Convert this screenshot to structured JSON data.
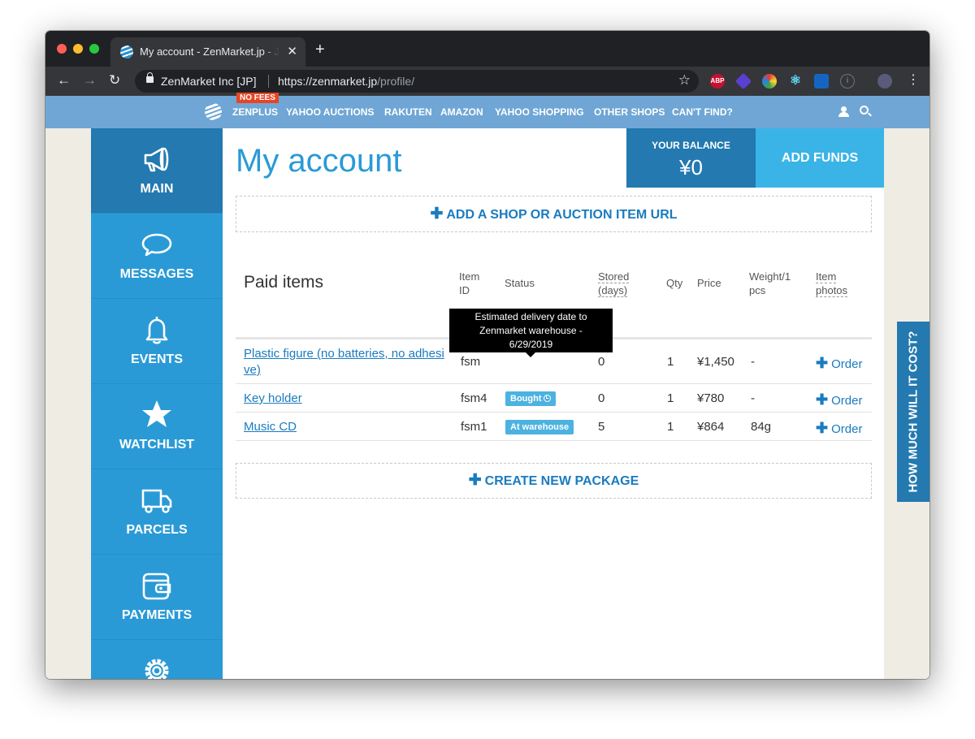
{
  "browser": {
    "tab_title": "My account - ZenMarket.jp - Japan",
    "site_name": "ZenMarket Inc [JP]",
    "url_host": "https://zenmarket.jp",
    "url_path": "/profile/",
    "ext_abp": "ABP"
  },
  "sitenav": {
    "badge": "NO FEES",
    "items": [
      "ZENPLUS",
      "YAHOO AUCTIONS",
      "RAKUTEN",
      "AMAZON",
      "YAHOO SHOPPING",
      "OTHER SHOPS",
      "CAN'T FIND?"
    ]
  },
  "sidebar": {
    "items": [
      {
        "label": "MAIN",
        "icon": "megaphone-icon"
      },
      {
        "label": "MESSAGES",
        "icon": "speech-bubble-icon"
      },
      {
        "label": "EVENTS",
        "icon": "bell-icon"
      },
      {
        "label": "WATCHLIST",
        "icon": "star-icon"
      },
      {
        "label": "PARCELS",
        "icon": "truck-icon"
      },
      {
        "label": "PAYMENTS",
        "icon": "wallet-icon"
      },
      {
        "label": "",
        "icon": "gear-icon"
      }
    ]
  },
  "main": {
    "title": "My account",
    "balance_label": "YOUR BALANCE",
    "balance_value": "¥0",
    "add_funds": "ADD FUNDS",
    "add_url": "ADD A SHOP OR AUCTION ITEM URL",
    "section_title": "Paid items",
    "columns": {
      "item_id_1": "Item",
      "item_id_2": "ID",
      "status": "Status",
      "stored_1": "Stored",
      "stored_2": "(days)",
      "qty": "Qty",
      "price": "Price",
      "weight_1": "Weight/1",
      "weight_2": "pcs",
      "photos_1": "Item",
      "photos_2": "photos"
    },
    "rows": [
      {
        "name_1": "Plastic figure (no batteries, no adhesi",
        "name_2": "ve)",
        "id": "fsm",
        "status": "",
        "stored": "0",
        "qty": "1",
        "price": "¥1,450",
        "weight": "-",
        "order": "Order"
      },
      {
        "name_1": "Key holder",
        "name_2": "",
        "id": "fsm4",
        "status": "Bought",
        "stored": "0",
        "qty": "1",
        "price": "¥780",
        "weight": "-",
        "order": "Order"
      },
      {
        "name_1": "Music CD",
        "name_2": "",
        "id": "fsm1",
        "status": "At warehouse",
        "stored": "5",
        "qty": "1",
        "price": "¥864",
        "weight": "84g",
        "order": "Order"
      }
    ],
    "tooltip_1": "Estimated delivery date to",
    "tooltip_2": "Zenmarket warehouse -",
    "tooltip_3": "6/29/2019",
    "create_package": "CREATE NEW PACKAGE",
    "how_much": "HOW MUCH WILL IT COST?"
  },
  "colors": {
    "brand_blue": "#2a9ad6",
    "dark_blue": "#2379b0",
    "light_blue": "#3ab4e6",
    "nav_blue": "#6fa6d5",
    "badge_red": "#e84524"
  }
}
